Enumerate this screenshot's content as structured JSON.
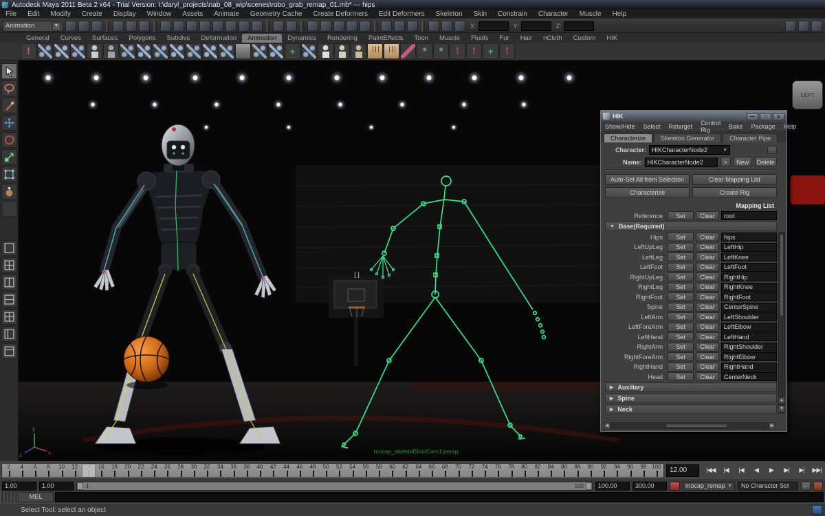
{
  "window": {
    "title": "Autodesk Maya 2011 Beta 2 x64 - Trial Version: I:\\daryl_projects\\nab_08_wip\\scenes\\robo_grab_remap_01.mb*  ---  hips"
  },
  "menu_bar": {
    "items": [
      "File",
      "Edit",
      "Modify",
      "Create",
      "Display",
      "Window",
      "Assets",
      "Animate",
      "Geometry Cache",
      "Create Deformers",
      "Edit Deformers",
      "Skeleton",
      "Skin",
      "Constrain",
      "Character",
      "Muscle",
      "Help"
    ]
  },
  "status_line": {
    "menu_set": "Animation",
    "dropdown_arrow": "▼",
    "coord_labels": {
      "x": "X:",
      "y": "Y:",
      "z": "Z:"
    },
    "icon_groups": [
      [
        "new-scene-icon",
        "open-scene-icon",
        "save-scene-icon"
      ],
      [
        "select-hierarchy-icon",
        "select-object-icon",
        "select-component-icon"
      ],
      [
        "mask-handles-icon",
        "mask-joints-icon",
        "mask-curves-icon",
        "mask-surfaces-icon",
        "mask-deformations-icon",
        "mask-dynamics-icon",
        "mask-rendering-icon",
        "mask-misc-icon"
      ],
      [
        "lock-selection-icon",
        "highlight-selection-icon"
      ],
      [
        "snap-grid-icon",
        "snap-curve-icon",
        "snap-point-icon",
        "snap-plane-icon",
        "make-live-icon"
      ],
      [
        "input-connections-icon",
        "output-connections-icon",
        "construction-history-icon"
      ],
      [
        "render-current-frame-icon",
        "ipr-render-icon",
        "render-settings-icon"
      ]
    ],
    "right_icons": [
      "show-attribute-editor-icon",
      "show-tool-settings-icon",
      "show-channel-box-icon"
    ]
  },
  "shelf": {
    "tabs": [
      "General",
      "Curves",
      "Surfaces",
      "Polygons",
      "Subdivs",
      "Deformation",
      "Animation",
      "Dynamics",
      "Rendering",
      "PaintEffects",
      "Toon",
      "Muscle",
      "Fluids",
      "Fur",
      "Hair",
      "nCloth",
      "Custom",
      "HIK"
    ],
    "active_tab": "Animation",
    "icons": [
      {
        "t": "bang",
        "c": "#cc6a6a"
      },
      {
        "t": "bone",
        "c": "#8fa9cc"
      },
      {
        "t": "bone",
        "c": "#9ab2d2"
      },
      {
        "t": "bone",
        "c": "#8fa9cc"
      },
      {
        "t": "person",
        "c": "#c9ced6"
      },
      {
        "t": "person",
        "c": "#9aa2ae"
      },
      {
        "t": "bone",
        "c": "#8fa9cc"
      },
      {
        "t": "bone",
        "c": "#9ab2d2"
      },
      {
        "t": "bone",
        "c": "#8fa9cc"
      },
      {
        "t": "bone",
        "c": "#9ab2d2"
      },
      {
        "t": "bone",
        "c": "#8fa9cc"
      },
      {
        "t": "bone",
        "c": "#9ab2d2"
      },
      {
        "t": "bone",
        "c": "#8fa9cc"
      },
      {
        "t": "trash",
        "c": "#9a9a9a"
      },
      {
        "t": "bone",
        "c": "#8fa9cc"
      },
      {
        "t": "bone",
        "c": "#9ab2d2"
      },
      {
        "t": "axis",
        "c": "#4fae5f"
      },
      {
        "t": "bone",
        "c": "#8fa9cc"
      },
      {
        "t": "person",
        "c": "#e0e0e0"
      },
      {
        "t": "person",
        "c": "#d8cdb8"
      },
      {
        "t": "person",
        "c": "#c8bba0"
      },
      {
        "t": "hand",
        "c": "#d9b88a"
      },
      {
        "t": "hand",
        "c": "#d9b88a"
      },
      {
        "t": "brush",
        "c": "#c45a7a"
      },
      {
        "t": "star",
        "c": "#3fc06a"
      },
      {
        "t": "star",
        "c": "#3fc06a"
      },
      {
        "t": "bang",
        "c": "#d04040"
      },
      {
        "t": "bang",
        "c": "#d04040"
      },
      {
        "t": "axis",
        "c": "#3fc06a"
      },
      {
        "t": "bang",
        "c": "#d04040"
      }
    ]
  },
  "toolbox": {
    "tools": [
      "select-tool",
      "lasso-tool",
      "paint-select-tool",
      "move-tool",
      "rotate-tool",
      "scale-tool",
      "universal-manipulator-tool",
      "soft-modification-tool",
      "last-tool"
    ],
    "layouts": [
      "single-pane-layout",
      "four-pane-layout",
      "two-pane-side-layout",
      "two-pane-stacked-layout",
      "three-pane-split-layout",
      "outliner-persp-layout",
      "hypergraph-persp-layout"
    ]
  },
  "viewport": {
    "panel_icons": [
      "select-camera-icon",
      "lock-camera-icon",
      "image-plane-icon",
      "bookmark-icon",
      "grease-pencil-icon",
      "grid-icon",
      "film-gate-icon",
      "resolution-gate-icon",
      "gate-mask-icon",
      "field-chart-icon",
      "safe-action-icon",
      "safe-title-icon",
      "fill-mode-icon",
      "wireframe-icon",
      "shaded-icon",
      "textured-icon",
      "use-all-lights-icon",
      "shadows-icon",
      "screen-space-ao-icon",
      "motion-blur-icon",
      "multisampling-icon",
      "isolate-select-icon",
      "xray-icon",
      "exposure-icon"
    ],
    "camera_label": "mocap_skeletalShotCam1:persp",
    "hud_marker": "[ ]",
    "axis": {
      "y": "y",
      "x": "x",
      "z": "z"
    },
    "skeleton_color": "#2fe58c"
  },
  "left_panel_button": {
    "label": "LEFT"
  },
  "hik": {
    "title": "HIK",
    "window_buttons": {
      "minimize": "—",
      "maximize": "□",
      "close": "×"
    },
    "menu": [
      "Show/Hide",
      "Select",
      "Retarget",
      "Control Rig",
      "Bake",
      "Package",
      "Help"
    ],
    "tabs": [
      "Characterize",
      "Skeleton Generator",
      "Character Pipe"
    ],
    "active_tab": "Characterize",
    "character_label": "Character:",
    "character_value": "HIKCharacterNode2",
    "name_label": "Name:",
    "name_value": "HIKCharacterNode2",
    "expand_button": ">",
    "new_button": "New",
    "delete_button": "Delete",
    "action_buttons": [
      "Auto-Set All from Selection",
      "Clear Mapping List",
      "Characterize",
      "Create Rig"
    ],
    "mapping_list_title": "Mapping List",
    "set_label": "Set",
    "clear_label": "Clear",
    "reference_row": {
      "label": "Reference",
      "value": "root"
    },
    "base_section_label": "Base(Required)",
    "mapping_rows": [
      {
        "label": "Hips",
        "value": "hips"
      },
      {
        "label": "LeftUpLeg",
        "value": "LeftHip"
      },
      {
        "label": "LeftLeg",
        "value": "LeftKnee"
      },
      {
        "label": "LeftFoot",
        "value": "LeftFoot"
      },
      {
        "label": "RightUpLeg",
        "value": "RightHip"
      },
      {
        "label": "RightLeg",
        "value": "RightKnee"
      },
      {
        "label": "RightFoot",
        "value": "RightFoot"
      },
      {
        "label": "Spine",
        "value": "CenterSpine"
      },
      {
        "label": "LeftArm",
        "value": "LeftShoulder"
      },
      {
        "label": "LeftForeArm",
        "value": "LeftElbow"
      },
      {
        "label": "LeftHand",
        "value": "LeftHand"
      },
      {
        "label": "RightArm",
        "value": "RightShoulder"
      },
      {
        "label": "RightForeArm",
        "value": "RightElbow"
      },
      {
        "label": "RightHand",
        "value": "RightHand"
      },
      {
        "label": "Head",
        "value": "CenterNeck"
      }
    ],
    "collapsed_sections": [
      "Auxiliary",
      "Spine",
      "Neck"
    ]
  },
  "timeline": {
    "ticks": [
      2,
      4,
      6,
      8,
      10,
      12,
      14,
      16,
      18,
      20,
      22,
      24,
      26,
      28,
      30,
      32,
      34,
      36,
      38,
      40,
      42,
      44,
      46,
      48,
      50,
      52,
      54,
      56,
      58,
      60,
      62,
      64,
      66,
      68,
      70,
      72,
      74,
      76,
      78,
      80,
      82,
      84,
      86,
      88,
      90,
      92,
      94,
      96,
      98,
      100
    ],
    "current_time": "12.00",
    "current_frame": 12,
    "playback_buttons": [
      {
        "name": "go-to-start-button",
        "glyph": "|◀◀"
      },
      {
        "name": "step-back-frame-button",
        "glyph": "|◀"
      },
      {
        "name": "step-back-key-button",
        "glyph": "|◀"
      },
      {
        "name": "play-backwards-button",
        "glyph": "◀"
      },
      {
        "name": "play-forwards-button",
        "glyph": "▶"
      },
      {
        "name": "step-forward-key-button",
        "glyph": "▶|"
      },
      {
        "name": "step-forward-frame-button",
        "glyph": "▶|"
      },
      {
        "name": "go-to-end-button",
        "glyph": "▶▶|"
      }
    ]
  },
  "range": {
    "anim_start": "1.00",
    "playback_start": "1.00",
    "range_min": "1",
    "range_max": "100",
    "playback_end": "100.00",
    "anim_end": "300.00",
    "anim_layer": "mocap_remap",
    "dropdown_arrow": "▼",
    "character_set": "No Character Set"
  },
  "command_line": {
    "label": "MEL",
    "value": ""
  },
  "help_line": {
    "text": "Select Tool: select an object"
  }
}
